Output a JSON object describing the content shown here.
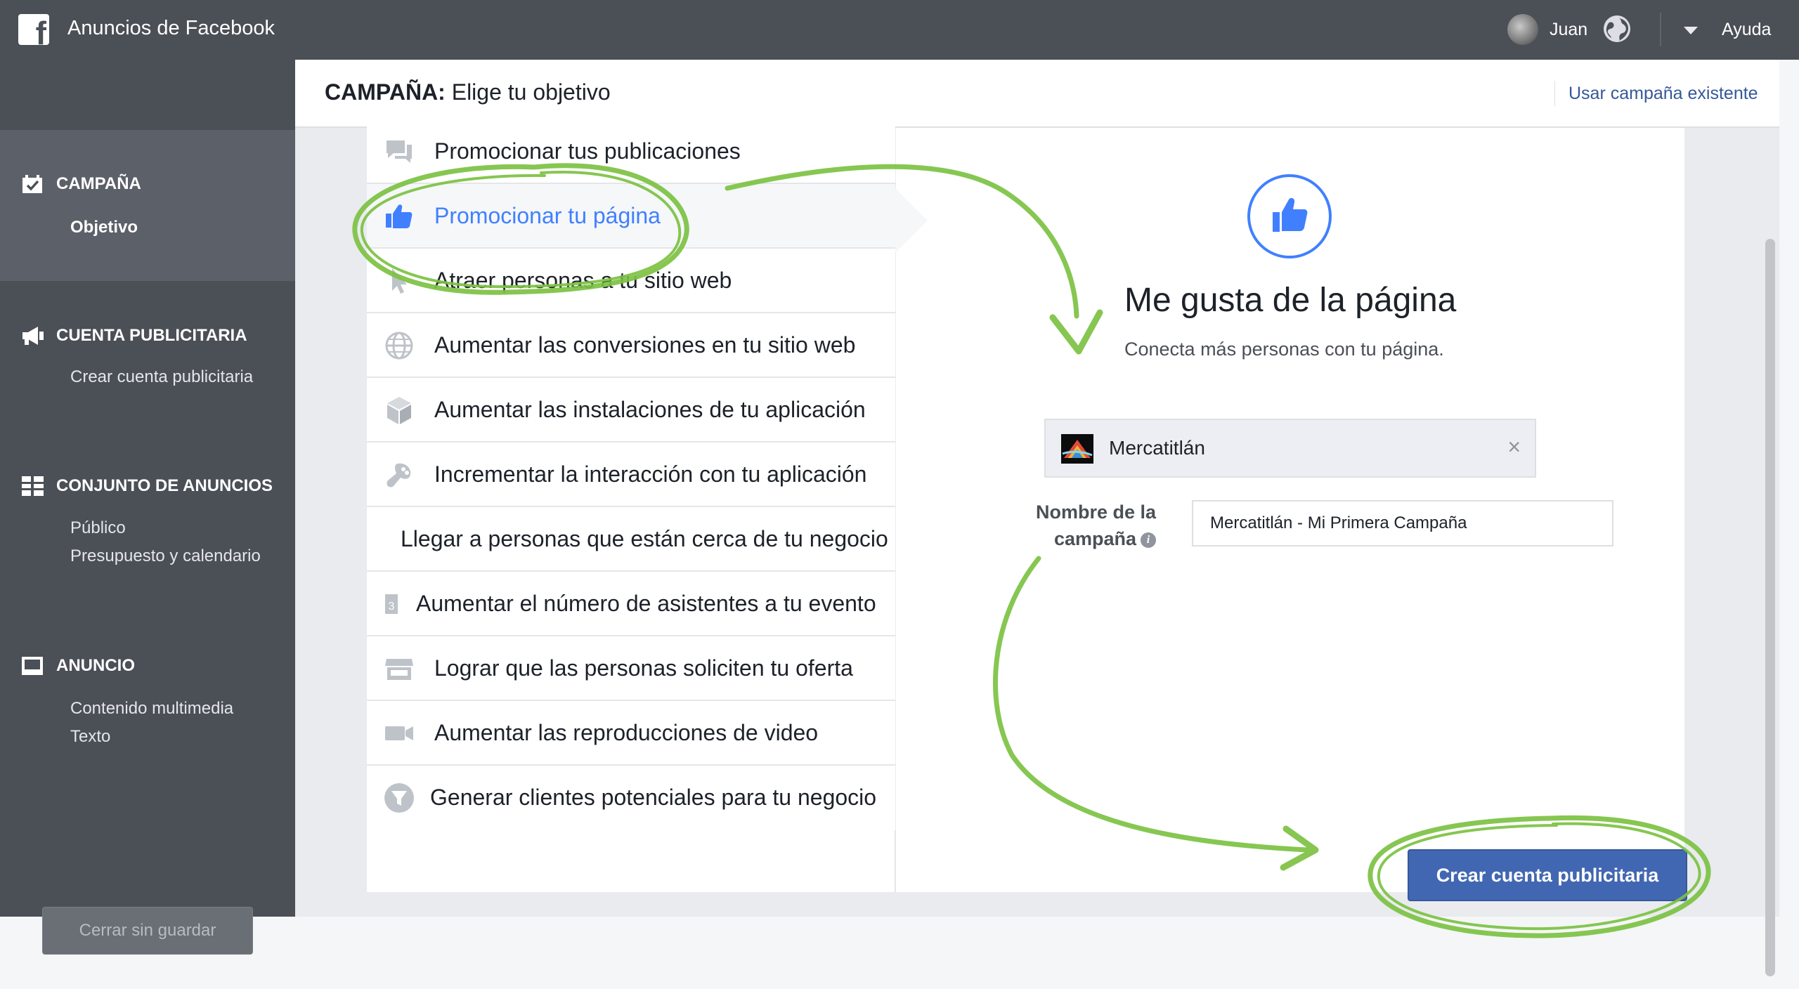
{
  "topbar": {
    "app_title": "Anuncios de Facebook",
    "user_name": "Juan",
    "help_label": "Ayuda",
    "logo_letter": "f"
  },
  "sidebar": {
    "sections": [
      {
        "title": "CAMPAÑA",
        "icon": "checkbox-icon",
        "items": [
          "Objetivo"
        ]
      },
      {
        "title": "CUENTA PUBLICITARIA",
        "icon": "megaphone-icon",
        "items": [
          "Crear cuenta publicitaria"
        ]
      },
      {
        "title": "CONJUNTO DE ANUNCIOS",
        "icon": "grid-icon",
        "items": [
          "Público",
          "Presupuesto y calendario"
        ]
      },
      {
        "title": "ANUNCIO",
        "icon": "monitor-icon",
        "items": [
          "Contenido multimedia",
          "Texto"
        ]
      }
    ],
    "close_button": "Cerrar sin guardar"
  },
  "header": {
    "title_bold": "CAMPAÑA:",
    "title_rest": " Elige tu objetivo",
    "existing_link": "Usar campaña existente"
  },
  "objectives": [
    {
      "label": "Promocionar tus publicaciones",
      "icon": "speech-bubbles-icon",
      "selected": false
    },
    {
      "label": "Promocionar tu página",
      "icon": "thumbs-up-icon",
      "selected": true
    },
    {
      "label": "Atraer personas a tu sitio web",
      "icon": "cursor-icon",
      "selected": false
    },
    {
      "label": "Aumentar las conversiones en tu sitio web",
      "icon": "globe-icon",
      "selected": false
    },
    {
      "label": "Aumentar las instalaciones de tu aplicación",
      "icon": "cube-icon",
      "selected": false
    },
    {
      "label": "Incrementar la interacción con tu aplicación",
      "icon": "gamepad-icon",
      "selected": false
    },
    {
      "label": "Llegar a personas que están cerca de tu negocio",
      "icon": "",
      "selected": false
    },
    {
      "label": "Aumentar el número de asistentes a tu evento",
      "icon": "calendar-icon",
      "selected": false
    },
    {
      "label": "Lograr que las personas soliciten tu oferta",
      "icon": "storefront-icon",
      "selected": false
    },
    {
      "label": "Aumentar las reproducciones de video",
      "icon": "video-camera-icon",
      "selected": false
    },
    {
      "label": "Generar clientes potenciales para tu negocio",
      "icon": "funnel-icon",
      "selected": false
    }
  ],
  "detail": {
    "title": "Me gusta de la página",
    "description": "Conecta más personas con tu página.",
    "page_name": "Mercatitlán",
    "field_label_line1": "Nombre de la",
    "field_label_line2": "campaña",
    "info_glyph": "i",
    "chip_close": "×",
    "campaign_name_value": "Mercatitlán - Mi Primera Campaña"
  },
  "create_button": "Crear cuenta publicitaria",
  "colors": {
    "accent": "#4080ff",
    "button": "#4267b2",
    "chrome": "#4b4f56",
    "annotation": "#7cc243"
  }
}
